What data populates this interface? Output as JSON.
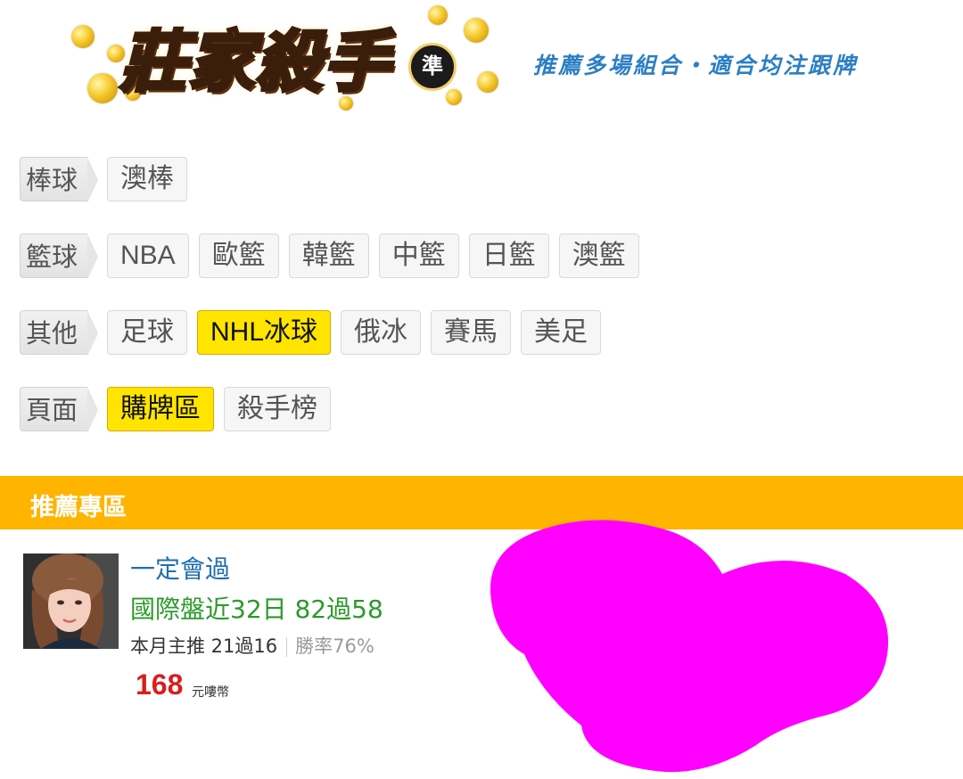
{
  "header": {
    "logo_text": "莊家殺手",
    "logo_badge": "準",
    "tagline": "推薦多場組合・適合均注跟牌"
  },
  "categories": [
    {
      "label": "棒球",
      "items": [
        {
          "label": "澳棒",
          "active": false
        }
      ]
    },
    {
      "label": "籃球",
      "items": [
        {
          "label": "NBA",
          "active": false
        },
        {
          "label": "歐籃",
          "active": false
        },
        {
          "label": "韓籃",
          "active": false
        },
        {
          "label": "中籃",
          "active": false
        },
        {
          "label": "日籃",
          "active": false
        },
        {
          "label": "澳籃",
          "active": false
        }
      ]
    },
    {
      "label": "其他",
      "items": [
        {
          "label": "足球",
          "active": false
        },
        {
          "label": "NHL冰球",
          "active": true
        },
        {
          "label": "俄冰",
          "active": false
        },
        {
          "label": "賽馬",
          "active": false
        },
        {
          "label": "美足",
          "active": false
        }
      ]
    },
    {
      "label": "頁面",
      "items": [
        {
          "label": "購牌區",
          "active": true
        },
        {
          "label": "殺手榜",
          "active": false
        }
      ]
    }
  ],
  "section": {
    "title": "推薦專區"
  },
  "card": {
    "name": "一定會過",
    "record": "國際盤近32日 82過58",
    "monthly": "本月主推 21過16",
    "win_rate": "勝率76%",
    "price": "168",
    "price_unit": "元嘍幣"
  },
  "colors": {
    "accent_yellow": "#ffb400",
    "active_chip": "#ffe400",
    "name_blue": "#1f6fae",
    "record_green": "#2a9a2a",
    "price_red": "#d81e1e",
    "redaction": "#ff00ff"
  }
}
